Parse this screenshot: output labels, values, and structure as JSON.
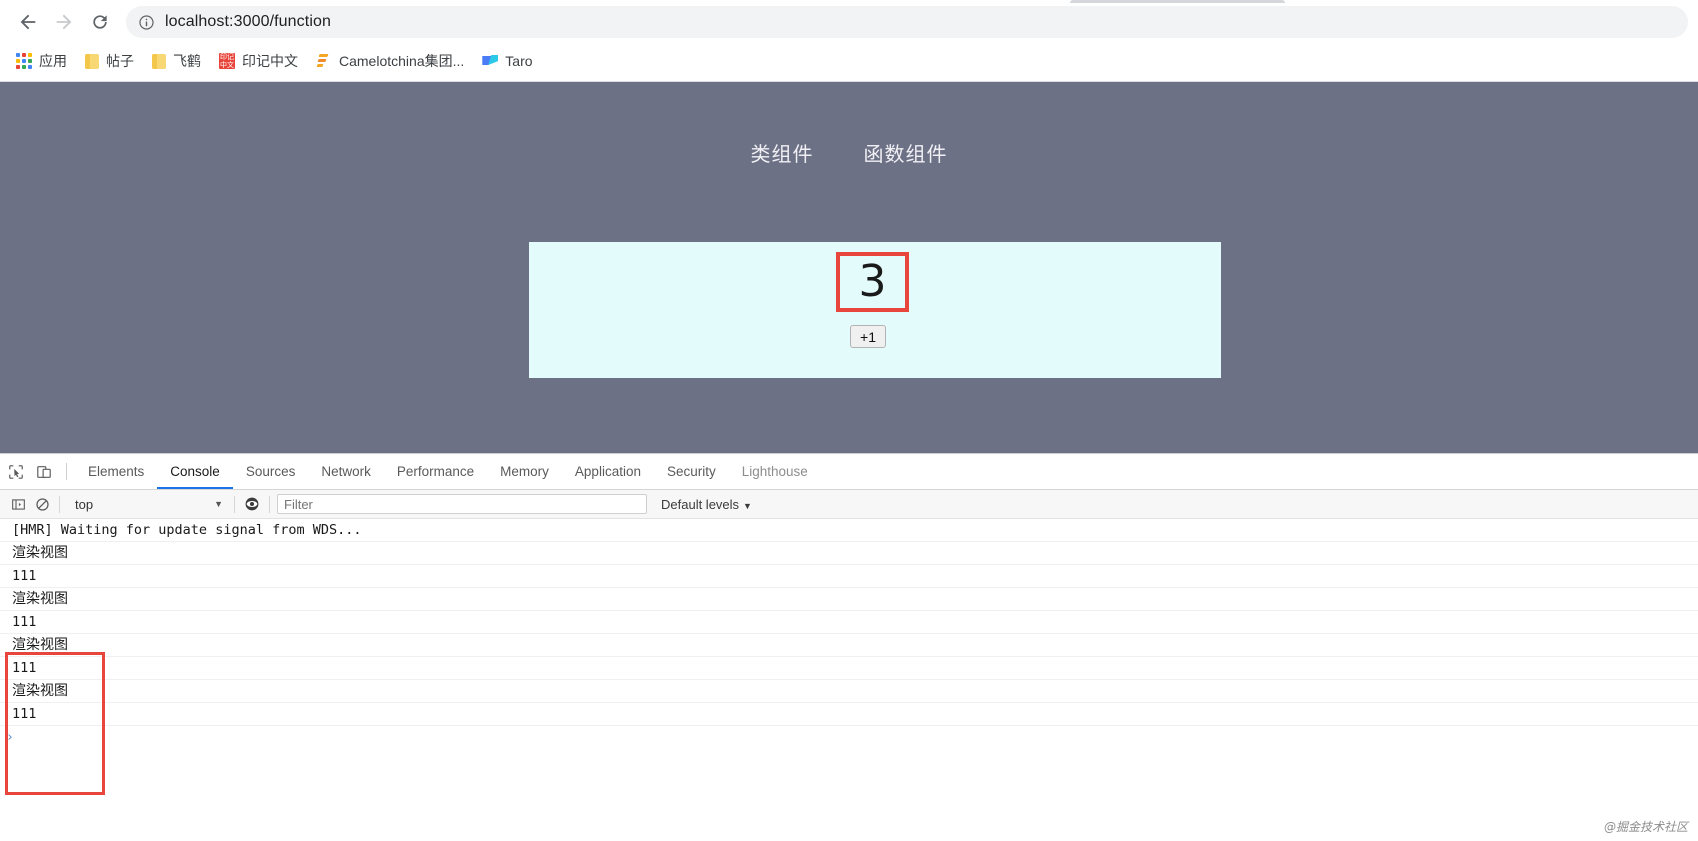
{
  "browser": {
    "nav": {
      "back_label": "Back",
      "forward_label": "Forward",
      "reload_label": "Reload"
    },
    "omnibox": {
      "url": "localhost:3000/function",
      "info_icon": "info-circle-icon"
    },
    "bookmarks": [
      {
        "label": "应用",
        "icon": "apps-grid-icon"
      },
      {
        "label": "帖子",
        "icon": "folder-icon"
      },
      {
        "label": "飞鹤",
        "icon": "folder-icon"
      },
      {
        "label": "印记中文",
        "icon": "yinji-icon"
      },
      {
        "label": "Camelotchina集团...",
        "icon": "camelot-icon"
      },
      {
        "label": "Taro",
        "icon": "taro-icon"
      }
    ]
  },
  "page": {
    "background_color": "#6d7186",
    "nav_links": [
      {
        "label": "类组件"
      },
      {
        "label": "函数组件"
      }
    ],
    "counter": {
      "panel_color": "#e4fbfb",
      "highlight_color": "#e8453c",
      "value": "3",
      "increment_label": "+1"
    }
  },
  "devtools": {
    "toolbar_icons": [
      {
        "name": "inspect-element-icon"
      },
      {
        "name": "device-toolbar-icon"
      }
    ],
    "tabs": [
      {
        "label": "Elements",
        "active": false
      },
      {
        "label": "Console",
        "active": true
      },
      {
        "label": "Sources",
        "active": false
      },
      {
        "label": "Network",
        "active": false
      },
      {
        "label": "Performance",
        "active": false
      },
      {
        "label": "Memory",
        "active": false
      },
      {
        "label": "Application",
        "active": false
      },
      {
        "label": "Security",
        "active": false
      },
      {
        "label": "Lighthouse",
        "active": false
      }
    ],
    "active_tab_accent": "#1a73e8",
    "filterbar": {
      "sidebar_toggle_icon": "console-sidebar-icon",
      "clear_icon": "clear-console-icon",
      "context": "top",
      "eye_icon": "live-expression-icon",
      "filter_placeholder": "Filter",
      "filter_value": "",
      "levels_label": "Default levels",
      "caret": "▼"
    },
    "console_logs": [
      {
        "text": "[HMR] Waiting for update signal from WDS...",
        "cjk": false
      },
      {
        "text": "渲染视图",
        "cjk": true
      },
      {
        "text": "111",
        "cjk": false
      },
      {
        "text": "渲染视图",
        "cjk": true
      },
      {
        "text": "111",
        "cjk": false
      },
      {
        "text": "渲染视图",
        "cjk": true
      },
      {
        "text": "111",
        "cjk": false
      },
      {
        "text": "渲染视图",
        "cjk": true
      },
      {
        "text": "111",
        "cjk": false
      }
    ],
    "prompt_symbol": "›"
  },
  "watermark": "@掘金技术社区"
}
